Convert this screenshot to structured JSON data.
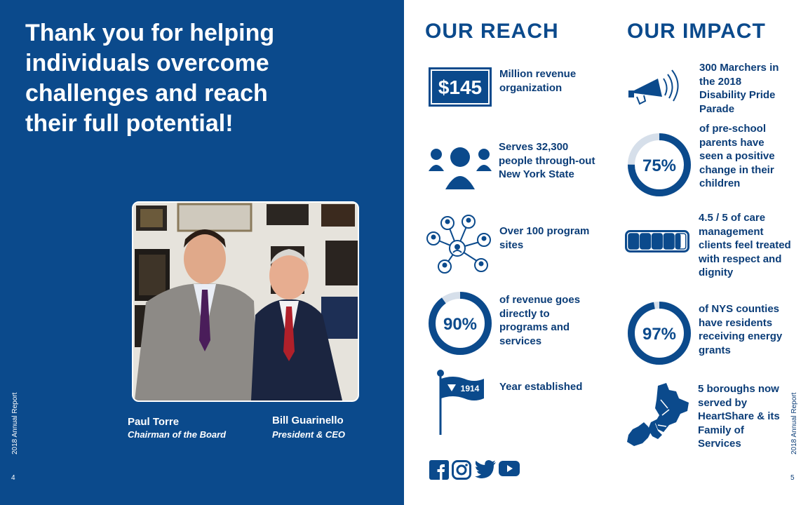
{
  "left": {
    "headline": "Thank you for helping individuals overcome challenges and reach their full potential!",
    "people": [
      {
        "name": "Paul Torre",
        "role": "Chairman of the Board"
      },
      {
        "name": "Bill Guarinello",
        "role": "President & CEO"
      }
    ],
    "vertical_label": "2018 Annual Report",
    "page_number": "4"
  },
  "reach": {
    "title": "OUR REACH",
    "revenue_badge": "$145",
    "revenue_text": "Million revenue organization",
    "serves_text": "Serves 32,300 people through-out New York State",
    "sites_text": "Over 100 program sites",
    "revenue_pct": {
      "value": "90%",
      "fraction": 0.9,
      "text": "of revenue goes directly to programs and services"
    },
    "flag_year": "1914",
    "year_text": "Year established"
  },
  "impact": {
    "title": "OUR IMPACT",
    "marchers_text": "300 Marchers in the 2018 Disability Pride Parade",
    "parents_pct": {
      "value": "75%",
      "fraction": 0.75,
      "text": "of pre-school parents have seen a positive change in their children"
    },
    "care_rating": {
      "value": 4.5,
      "max": 5,
      "text": "4.5 / 5 of care management clients feel treated with respect and dignity"
    },
    "counties_pct": {
      "value": "97%",
      "fraction": 0.97,
      "text": "of NYS counties have residents receiving energy grants"
    },
    "boroughs_text": "5 boroughs now served by HeartShare & its Family of Services"
  },
  "social": [
    "facebook-icon",
    "instagram-icon",
    "twitter-icon",
    "youtube-icon"
  ],
  "right_vertical_label": "2018 Annual Report",
  "right_page_number": "5",
  "colors": {
    "navy": "#0b4a8c",
    "dark_text": "#0b3d78",
    "white": "#ffffff"
  }
}
